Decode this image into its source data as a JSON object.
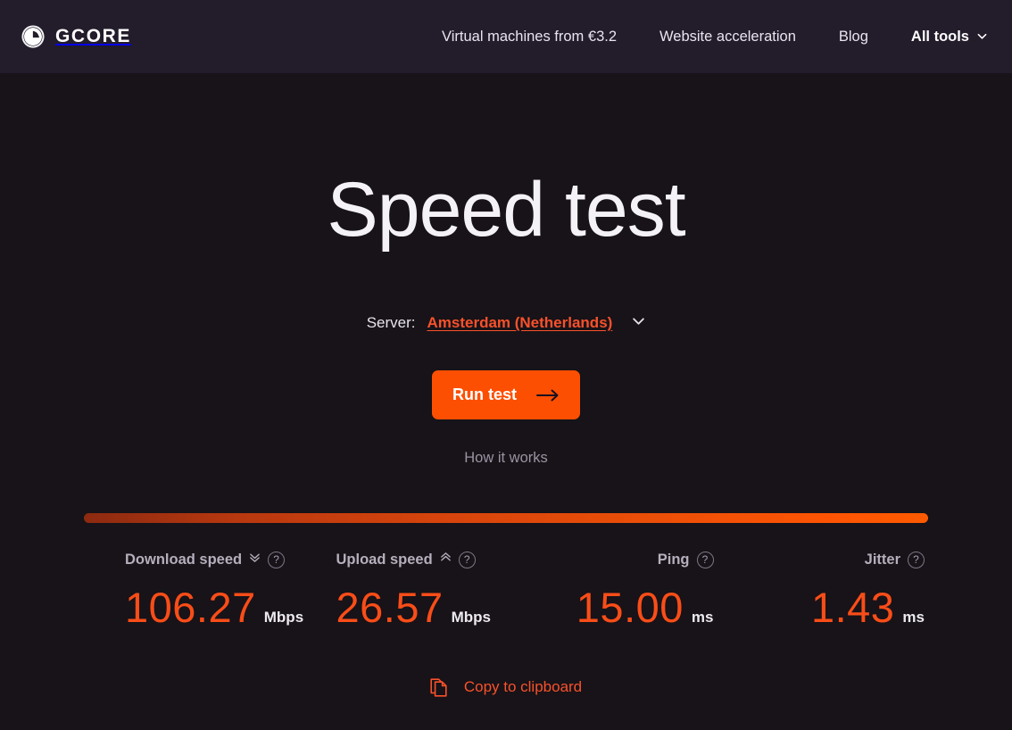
{
  "header": {
    "logo_word": "GCORE",
    "logo_icon": "gcore-circle-g-logo",
    "nav": [
      {
        "label": "Virtual machines from €3.2",
        "name": "nav-virtual-machines"
      },
      {
        "label": "Website acceleration",
        "name": "nav-website-acceleration"
      },
      {
        "label": "Blog",
        "name": "nav-blog"
      }
    ],
    "tools": {
      "label": "All tools",
      "icon": "chevron-down-icon"
    }
  },
  "hero": {
    "title": "Speed test",
    "server_label": "Server:",
    "server_value": "Amsterdam (Netherlands)",
    "server_chevron": "chevron-down-icon",
    "run_button": "Run test",
    "run_button_icon": "arrow-right-icon",
    "how_it_works": "How it works"
  },
  "results": {
    "progress_percent": 100,
    "progress_gradient_start": "#8c2a10",
    "progress_gradient_end": "#ff5a00",
    "accent_color": "#f94d18",
    "metrics": [
      {
        "name": "download",
        "label": "Download speed",
        "arrow_icon": "double-chevron-down-icon",
        "help": "?",
        "value": "106.27",
        "unit": "Mbps"
      },
      {
        "name": "upload",
        "label": "Upload speed",
        "arrow_icon": "double-chevron-up-icon",
        "help": "?",
        "value": "26.57",
        "unit": "Mbps"
      },
      {
        "name": "ping",
        "label": "Ping",
        "arrow_icon": null,
        "help": "?",
        "value": "15.00",
        "unit": "ms"
      },
      {
        "name": "jitter",
        "label": "Jitter",
        "arrow_icon": null,
        "help": "?",
        "value": "1.43",
        "unit": "ms"
      }
    ],
    "copy": {
      "label": "Copy to clipboard",
      "icon": "copy-document-icon"
    }
  }
}
